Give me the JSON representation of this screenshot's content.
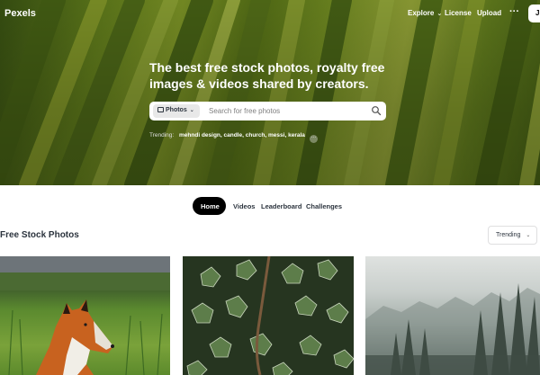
{
  "topbar": {
    "logo": "Pexels",
    "nav": {
      "explore": "Explore",
      "license": "License",
      "upload": "Upload",
      "more": "···",
      "join": "J"
    }
  },
  "hero": {
    "headline": "The best free stock photos, royalty free images & videos shared by creators.",
    "search": {
      "type_label": "Photos",
      "placeholder": "Search for free photos"
    },
    "trending": {
      "label": "Trending:",
      "terms": [
        "mehndi design,",
        "candle,",
        "church,",
        "messi,",
        "kerala"
      ],
      "more": "···"
    }
  },
  "tabs": [
    "Home",
    "Videos",
    "Leaderboard",
    "Challenges"
  ],
  "feed": {
    "title": "Free Stock Photos",
    "sort_label": "Trending"
  },
  "photos": [
    {
      "subject": "fox in grass"
    },
    {
      "subject": "ivy leaves"
    },
    {
      "subject": "misty forest"
    }
  ],
  "colors": {
    "hero_green": "#6b8a1e",
    "tab_active_bg": "#000000",
    "text_dark": "#2c343e"
  }
}
